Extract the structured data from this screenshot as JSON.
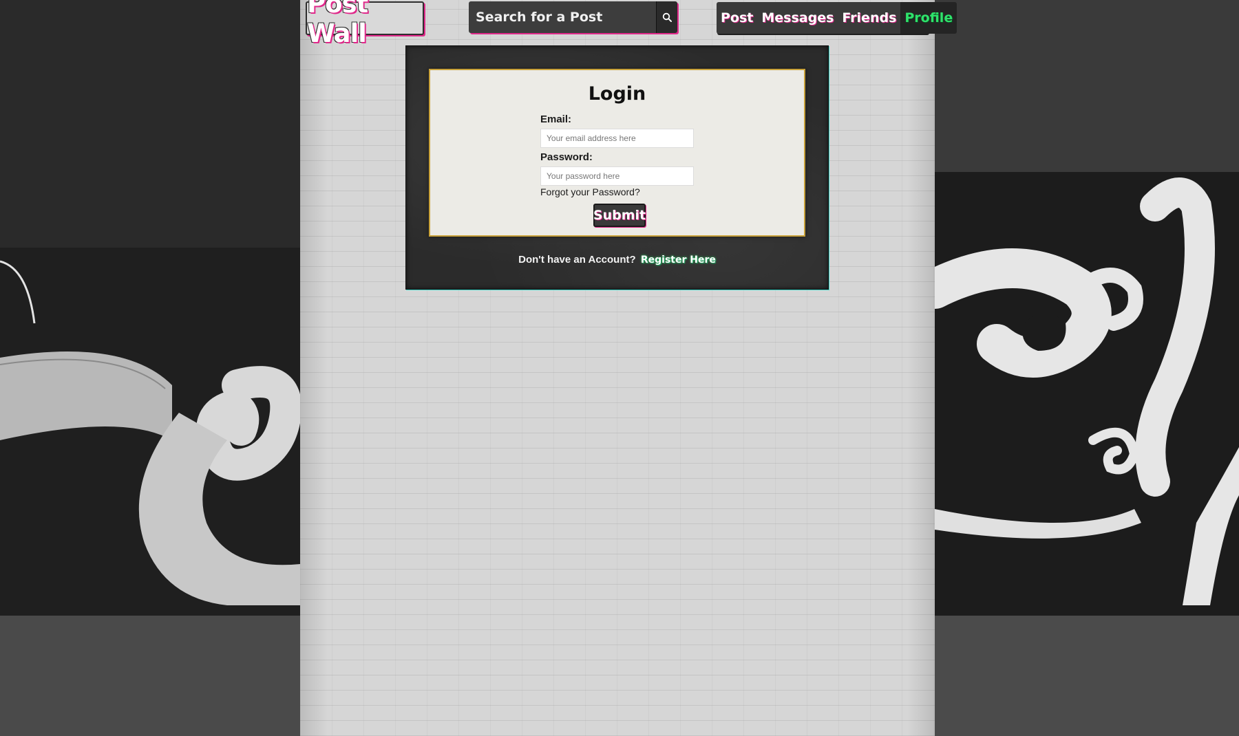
{
  "app": {
    "logo_text": "Post Wall"
  },
  "search": {
    "placeholder": "Search for a Post",
    "icon": "search-icon"
  },
  "nav": {
    "items": [
      {
        "label": "Post",
        "active": false
      },
      {
        "label": "Messages",
        "active": false
      },
      {
        "label": "Friends",
        "active": false
      },
      {
        "label": "Profile",
        "active": true
      }
    ]
  },
  "login": {
    "title": "Login",
    "email_label": "Email:",
    "email_placeholder": "Your email address here",
    "email_value": "",
    "password_label": "Password:",
    "password_placeholder": "Your password here",
    "password_value": "",
    "forgot_text": "Forgot your Password?",
    "submit_label": "Submit",
    "register_prompt": "Don't have an Account?",
    "register_link": "Register Here"
  },
  "colors": {
    "accent_pink": "#e0288a",
    "accent_green": "#2fe26b",
    "card_border_gold": "#c9a23a",
    "panel_dark": "#2b2b2b"
  }
}
